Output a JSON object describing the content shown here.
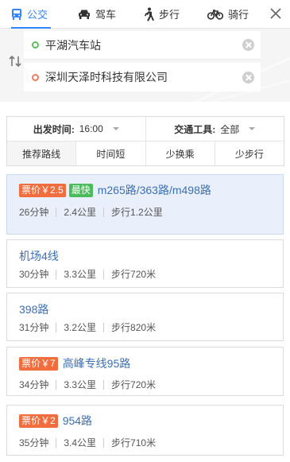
{
  "modes": [
    {
      "label": "公交",
      "icon": "bus-icon",
      "active": true
    },
    {
      "label": "驾车",
      "icon": "car-icon",
      "active": false
    },
    {
      "label": "步行",
      "icon": "walk-icon",
      "active": false
    },
    {
      "label": "骑行",
      "icon": "bike-icon",
      "active": false
    }
  ],
  "search": {
    "start": "平湖汽车站",
    "end": "深圳天泽时科技有限公司"
  },
  "filters": {
    "depart_label": "出发时间:",
    "depart_value": "16:00",
    "tool_label": "交通工具:",
    "tool_value": "全部"
  },
  "sort_tabs": [
    "推荐路线",
    "时间短",
    "少换乘",
    "少步行"
  ],
  "routes": [
    {
      "price": "票价￥2.5",
      "fast": "最快",
      "name": "m265路/363路/m498路",
      "duration": "26分钟",
      "distance": "2.4公里",
      "walk": "步行1.2公里"
    },
    {
      "price": "",
      "fast": "",
      "name": "机场4线",
      "duration": "30分钟",
      "distance": "3.3公里",
      "walk": "步行720米"
    },
    {
      "price": "",
      "fast": "",
      "name": "398路",
      "duration": "31分钟",
      "distance": "3.2公里",
      "walk": "步行820米"
    },
    {
      "price": "票价￥7",
      "fast": "",
      "name": "高峰专线95路",
      "duration": "34分钟",
      "distance": "3.3公里",
      "walk": "步行720米"
    },
    {
      "price": "票价￥2",
      "fast": "",
      "name": "954路",
      "duration": "35分钟",
      "distance": "3.4公里",
      "walk": "步行710米"
    }
  ],
  "colors": {
    "accent": "#3385ff",
    "link": "#3c6fb8",
    "price_tag": "#f26d3d",
    "fast_tag": "#4cbb5b",
    "selected_bg": "#e9f0fb"
  }
}
